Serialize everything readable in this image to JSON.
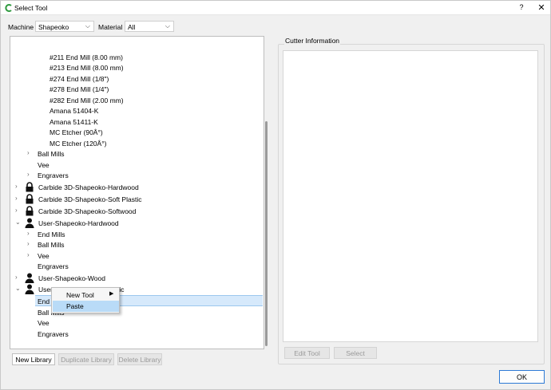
{
  "window": {
    "title": "Select Tool",
    "help": "?",
    "close": "✕"
  },
  "filters": {
    "machine_label": "Machine",
    "machine_value": "Shapeoko",
    "material_label": "Material",
    "material_value": "All"
  },
  "tree": {
    "end_mills": [
      "#211 End Mill (8.00 mm)",
      "#213 End Mill (8.00 mm)",
      "#274 End Mill (1/8\")",
      "#278 End Mill (1/4\")",
      "#282 End Mill (2.00 mm)",
      "Amana 51404-K",
      "Amana 51411-K",
      "MC Etcher (90Â°)",
      "MC Etcher (120Â°)"
    ],
    "ball_mills": "Ball Mills",
    "vee": "Vee",
    "engravers": "Engravers",
    "lib_hardwood": "Carbide 3D-Shapeoko-Hardwood",
    "lib_soft_plastic": "Carbide 3D-Shapeoko-Soft Plastic",
    "lib_softwood": "Carbide 3D-Shapeoko-Softwood",
    "user_hardwood": "User-Shapeoko-Hardwood",
    "end_mills_label": "End Mills",
    "user_wood": "User-Shapeoko-Wood",
    "user_plastic_prefix": "User",
    "user_plastic_suffix": "tic",
    "end_partial": "End",
    "ball_mills_partial": "Ball Mills"
  },
  "context_menu": {
    "new_tool": "New Tool",
    "paste": "Paste"
  },
  "buttons": {
    "new_library": "New Library",
    "duplicate_library": "Duplicate Library",
    "delete_library": "Delete Library",
    "edit_tool": "Edit Tool",
    "select": "Select",
    "ok": "OK"
  },
  "cutter_info": {
    "title": "Cutter Information"
  },
  "colors": {
    "selection": "#d6e9fb",
    "menu_highlight": "#b9dbf7",
    "ok_border": "#2d7ad6",
    "app_icon": "#2e9a3e"
  }
}
